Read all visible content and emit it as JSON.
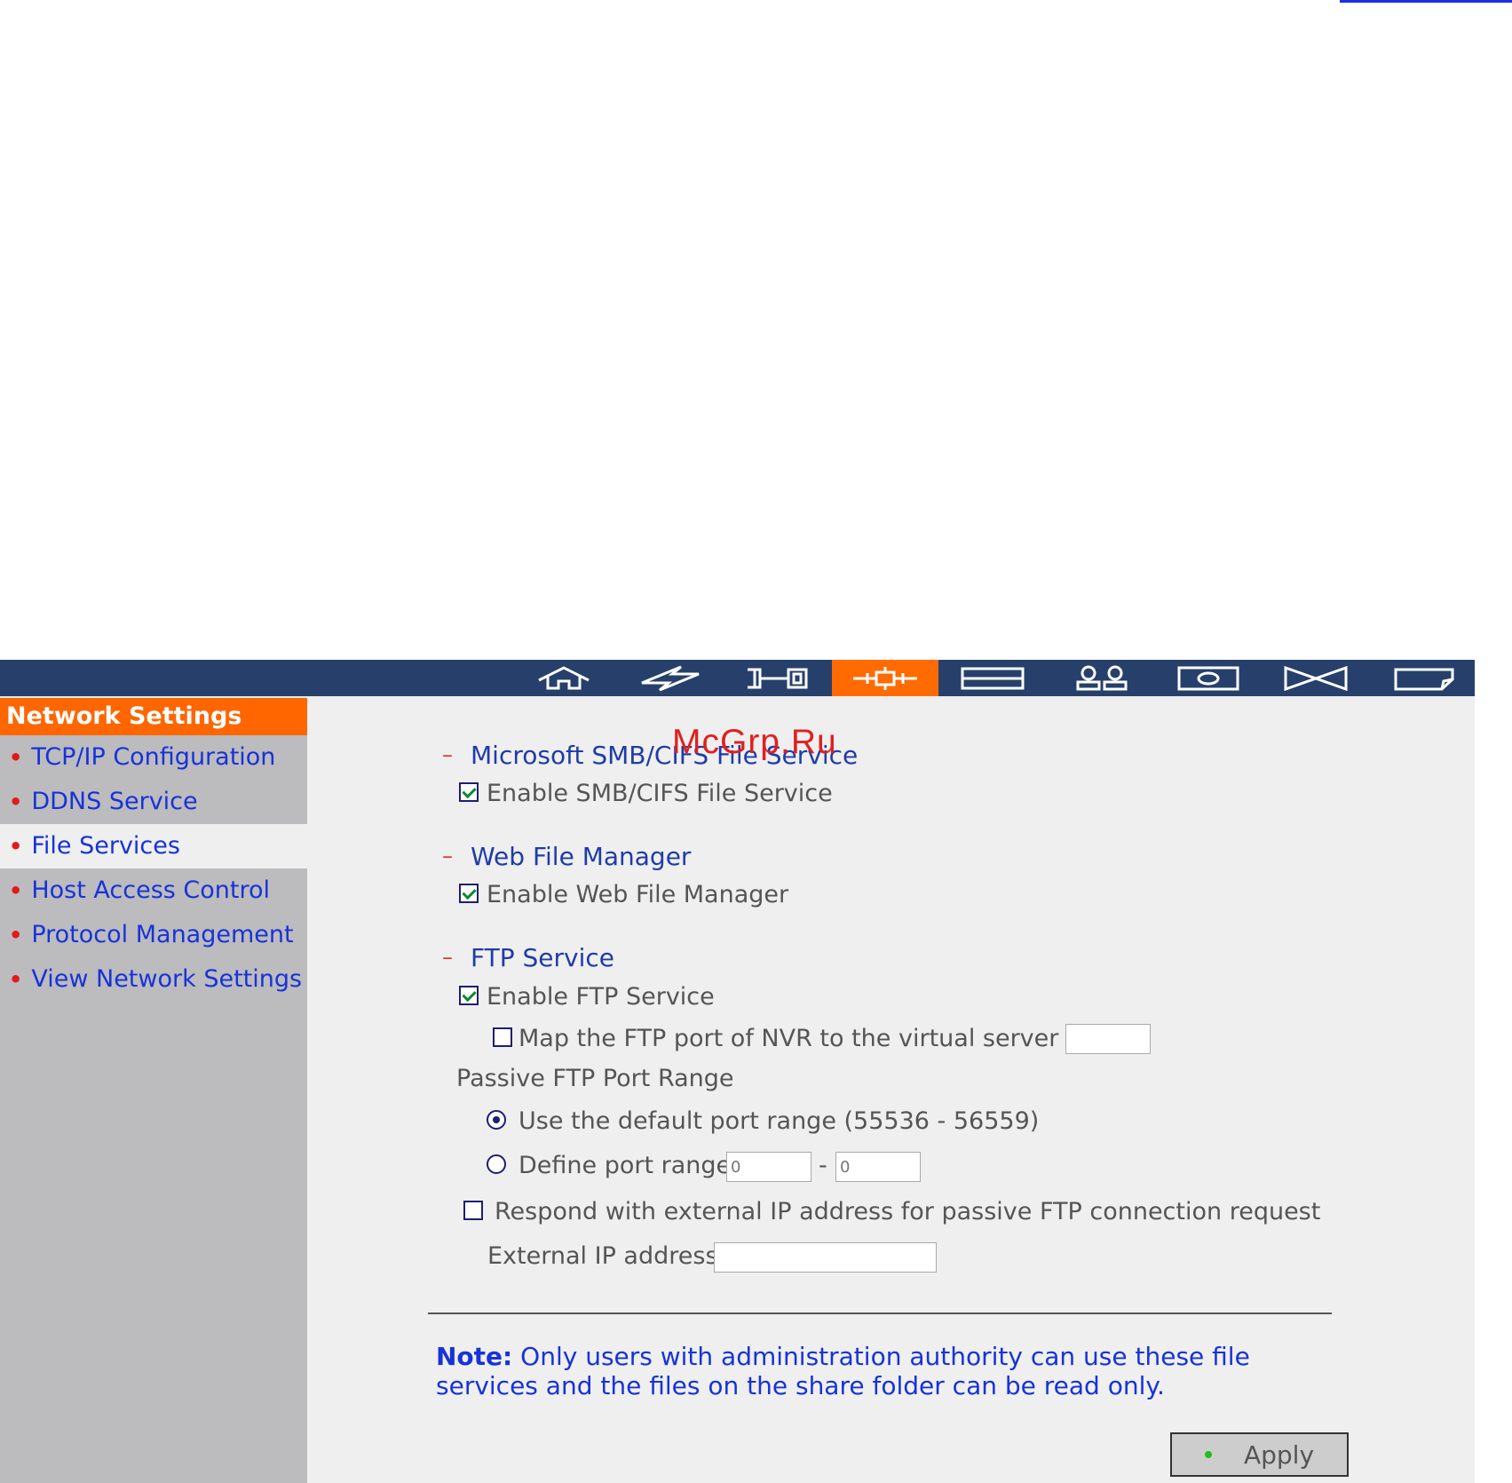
{
  "watermark": "McGrp.Ru",
  "colors": {
    "navbar": "#27406b",
    "accent": "#ff6600",
    "sidebar": "#bcbbbd",
    "link": "#1733d9"
  },
  "navbar": {
    "icons": [
      "home-icon",
      "lightning-icon",
      "connector-icon",
      "network-icon",
      "disk-icon",
      "users-icon",
      "camera-icon",
      "bowtie-icon",
      "tag-icon"
    ],
    "active": "network-icon"
  },
  "sidebar": {
    "title": "Network Settings",
    "items": [
      {
        "label": "TCP/IP Configuration"
      },
      {
        "label": "DDNS Service"
      },
      {
        "label": "File Services"
      },
      {
        "label": "Host Access Control"
      },
      {
        "label": "Protocol Management"
      },
      {
        "label": "View Network Settings"
      }
    ],
    "selected": "File Services"
  },
  "smb": {
    "title": "Microsoft SMB/CIFS File Service",
    "enable_label": "Enable SMB/CIFS File Service",
    "enabled": true
  },
  "web_file_manager": {
    "title": "Web File Manager",
    "enable_label": "Enable Web File Manager",
    "enabled": true
  },
  "ftp": {
    "title": "FTP Service",
    "enable_label": "Enable FTP Service",
    "enabled": true,
    "map_label": "Map the FTP port of NVR to the virtual server as",
    "map_checked": false,
    "map_value": "",
    "passive_title": "Passive FTP Port Range",
    "default_range_label": "Use the default port range (55536 - 56559)",
    "define_range_label": "Define port range:",
    "range_separator": "-",
    "range_from_placeholder": "0",
    "range_to_placeholder": "0",
    "respond_label": "Respond with external IP address for passive FTP connection request",
    "respond_checked": false,
    "external_ip_label": "External IP address:",
    "external_ip_value": ""
  },
  "note": {
    "prefix": "Note:",
    "text": "Only users with administration authority can use these file services and the files on the share folder can be read only."
  },
  "apply_label": "Apply"
}
